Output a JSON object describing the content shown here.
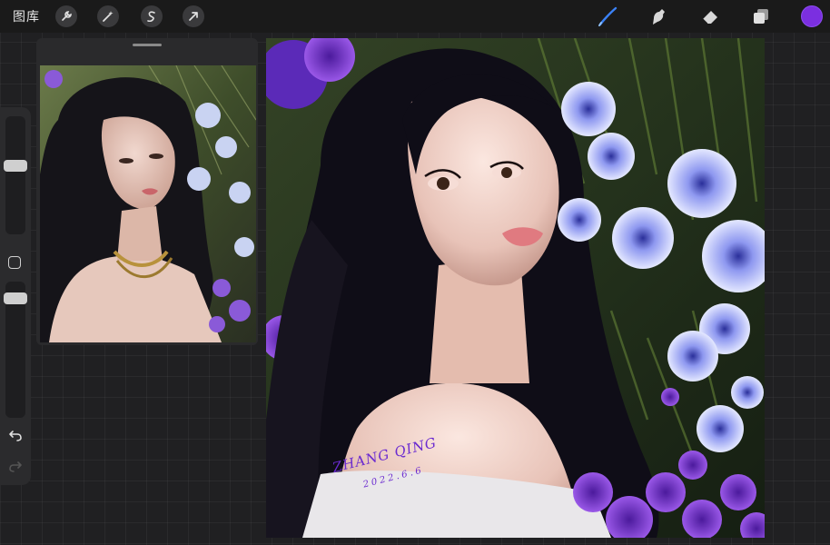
{
  "header": {
    "gallery_label": "图库",
    "left_tools": [
      "wrench-icon",
      "magic-wand-icon",
      "selection-icon",
      "transform-arrow-icon"
    ],
    "right_tools": [
      "brush-icon",
      "smudge-icon",
      "eraser-icon",
      "layers-icon"
    ],
    "current_color": "#7b2fe0",
    "active_tool_color": "#3b82f6"
  },
  "sidebar": {
    "size_level": 0.3,
    "opacity_level": 0.35,
    "tools": [
      "modify-square-icon",
      "undo-icon",
      "redo-icon"
    ]
  },
  "reference": {
    "description_visible": false
  },
  "canvas": {
    "signature_name": "ZHANG QING",
    "signature_date": "2022.6.6"
  }
}
